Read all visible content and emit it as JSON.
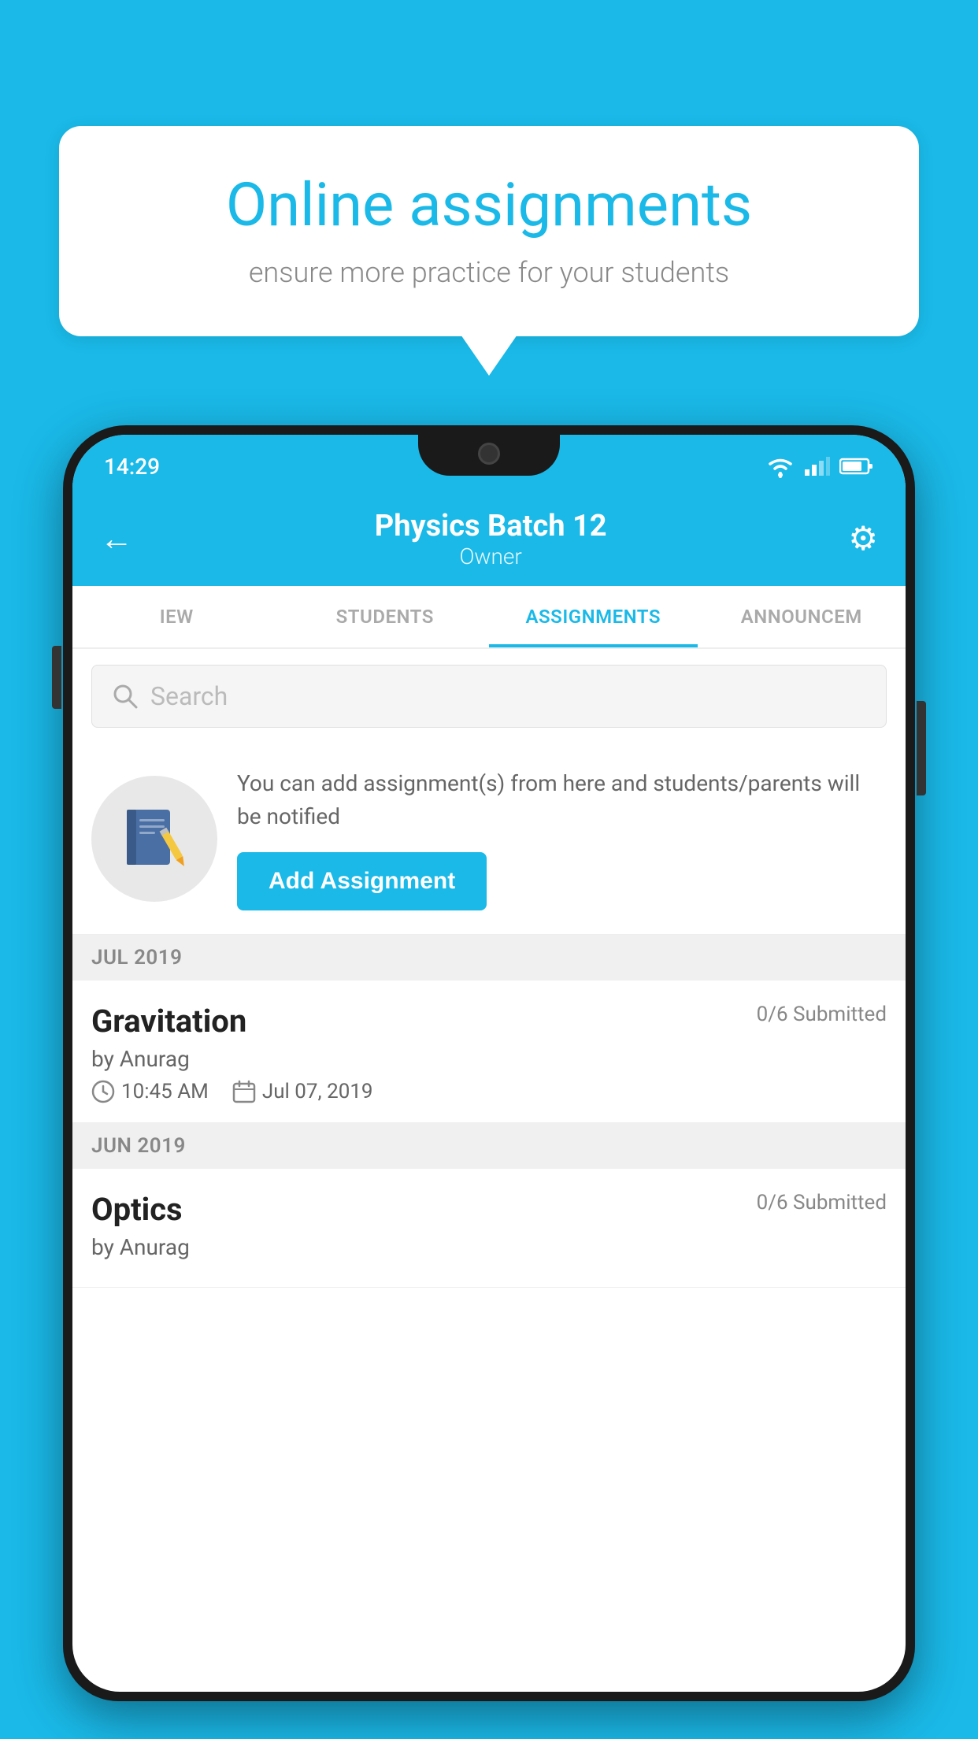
{
  "background_color": "#1ab9e8",
  "bubble": {
    "title": "Online assignments",
    "subtitle": "ensure more practice for your students"
  },
  "phone": {
    "status_bar": {
      "time": "14:29"
    },
    "header": {
      "title": "Physics Batch 12",
      "subtitle": "Owner",
      "back_label": "←",
      "settings_label": "⚙"
    },
    "tabs": [
      {
        "label": "IEW",
        "active": false
      },
      {
        "label": "STUDENTS",
        "active": false
      },
      {
        "label": "ASSIGNMENTS",
        "active": true
      },
      {
        "label": "ANNOUNCEM",
        "active": false
      }
    ],
    "search": {
      "placeholder": "Search"
    },
    "promo": {
      "description": "You can add assignment(s) from here and students/parents will be notified",
      "button_label": "Add Assignment"
    },
    "sections": [
      {
        "header": "JUL 2019",
        "assignments": [
          {
            "title": "Gravitation",
            "submitted": "0/6 Submitted",
            "by": "by Anurag",
            "time": "10:45 AM",
            "date": "Jul 07, 2019"
          }
        ]
      },
      {
        "header": "JUN 2019",
        "assignments": [
          {
            "title": "Optics",
            "submitted": "0/6 Submitted",
            "by": "by Anurag",
            "time": "",
            "date": ""
          }
        ]
      }
    ]
  }
}
